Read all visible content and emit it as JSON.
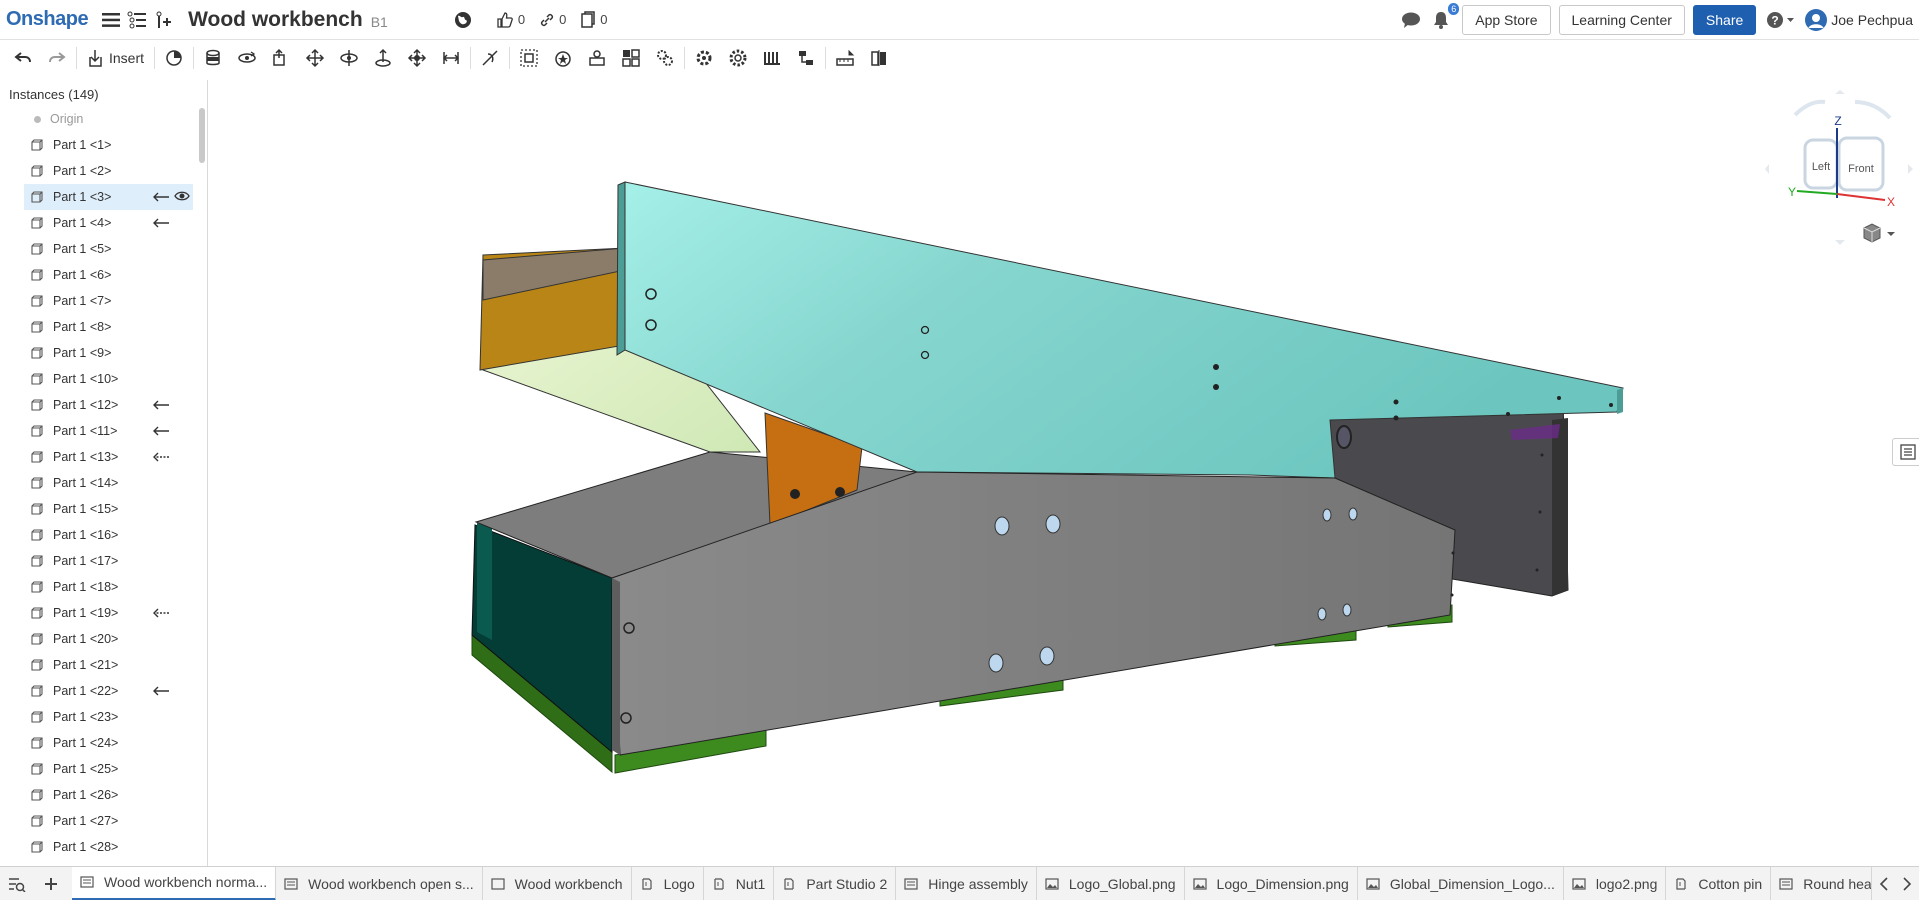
{
  "app": {
    "logo": "Onshape"
  },
  "document": {
    "title": "Wood workbench",
    "version": "B1"
  },
  "counters": {
    "likes": "0",
    "links": "0",
    "copies": "0"
  },
  "header": {
    "notifications_count": "6",
    "app_store": "App Store",
    "learning_center": "Learning Center",
    "share": "Share",
    "user_name": "Joe Pechpua"
  },
  "toolbar": {
    "insert_label": "Insert"
  },
  "instances": {
    "header": "Instances (149)",
    "origin": "Origin",
    "items": [
      "Part 1 <1>",
      "Part 1 <2>",
      "Part 1 <3>",
      "Part 1 <4>",
      "Part 1 <5>",
      "Part 1 <6>",
      "Part 1 <7>",
      "Part 1 <8>",
      "Part 1 <9>",
      "Part 1 <10>",
      "Part 1 <12>",
      "Part 1 <11>",
      "Part 1 <13>",
      "Part 1 <14>",
      "Part 1 <15>",
      "Part 1 <16>",
      "Part 1 <17>",
      "Part 1 <18>",
      "Part 1 <19>",
      "Part 1 <20>",
      "Part 1 <21>",
      "Part 1 <22>",
      "Part 1 <23>",
      "Part 1 <24>",
      "Part 1 <25>",
      "Part 1 <26>",
      "Part 1 <27>",
      "Part 1 <28>"
    ],
    "selected_item": "Part 1 <3>"
  },
  "view_cube": {
    "top_label": "Z",
    "left_face": "Left",
    "front_face": "Front",
    "axis_x": "X",
    "axis_y": "Y"
  },
  "tabs": [
    {
      "label": "Wood workbench norma...",
      "icon": "assembly-icon",
      "active": true
    },
    {
      "label": "Wood workbench open s...",
      "icon": "assembly-icon"
    },
    {
      "label": "Wood workbench",
      "icon": "drawing-icon"
    },
    {
      "label": "Logo",
      "icon": "part-studio-icon"
    },
    {
      "label": "Nut1",
      "icon": "part-studio-icon"
    },
    {
      "label": "Part Studio 2",
      "icon": "part-studio-icon"
    },
    {
      "label": "Hinge assembly",
      "icon": "assembly-icon"
    },
    {
      "label": "Logo_Global.png",
      "icon": "image-icon"
    },
    {
      "label": "Logo_Dimension.png",
      "icon": "image-icon"
    },
    {
      "label": "Global_Dimension_Logo...",
      "icon": "image-icon"
    },
    {
      "label": "logo2.png",
      "icon": "image-icon"
    },
    {
      "label": "Cotton pin",
      "icon": "part-studio-icon"
    },
    {
      "label": "Round head bolt",
      "icon": "assembly-icon"
    }
  ],
  "colors": {
    "brand": "#2e6bb3",
    "share_button": "#1f5fb0",
    "selection": "#dfeefb"
  }
}
